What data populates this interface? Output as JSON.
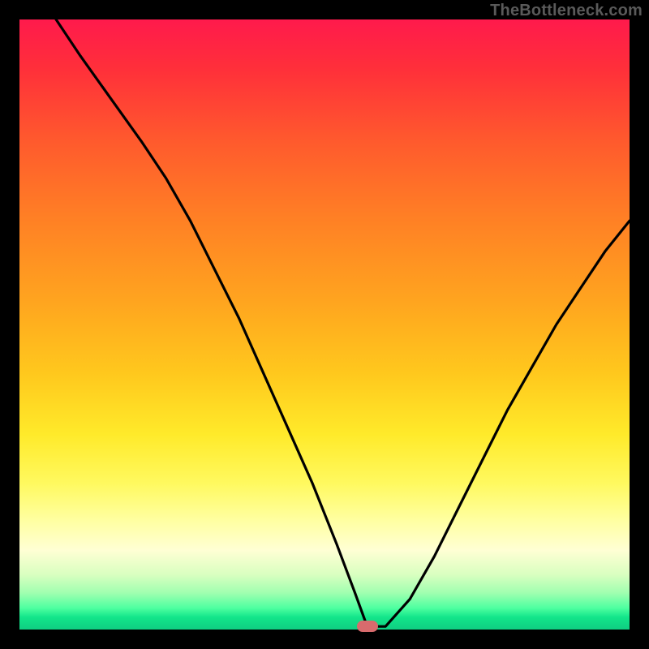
{
  "watermark": "TheBottleneck.com",
  "chart_data": {
    "type": "line",
    "title": "",
    "xlabel": "",
    "ylabel": "",
    "xlim": [
      0,
      100
    ],
    "ylim": [
      0,
      100
    ],
    "grid": false,
    "legend": false,
    "marker": {
      "x": 57,
      "y": 0.5,
      "color": "#d86b6d"
    },
    "series": [
      {
        "name": "bottleneck-curve",
        "x": [
          6,
          10,
          15,
          20,
          24,
          28,
          32,
          36,
          40,
          44,
          48,
          52,
          55,
          57,
          60,
          64,
          68,
          72,
          76,
          80,
          84,
          88,
          92,
          96,
          100
        ],
        "y": [
          100,
          94,
          87,
          80,
          74,
          67,
          59,
          51,
          42,
          33,
          24,
          14,
          6,
          0.5,
          0.5,
          5,
          12,
          20,
          28,
          36,
          43,
          50,
          56,
          62,
          67
        ],
        "color": "#000000"
      }
    ],
    "background_gradient": {
      "direction": "vertical",
      "stops": [
        {
          "pos": 0.0,
          "color": "#ff1a4c"
        },
        {
          "pos": 0.68,
          "color": "#ffea2a"
        },
        {
          "pos": 0.87,
          "color": "#ffffd4"
        },
        {
          "pos": 1.0,
          "color": "#0fce82"
        }
      ]
    }
  }
}
